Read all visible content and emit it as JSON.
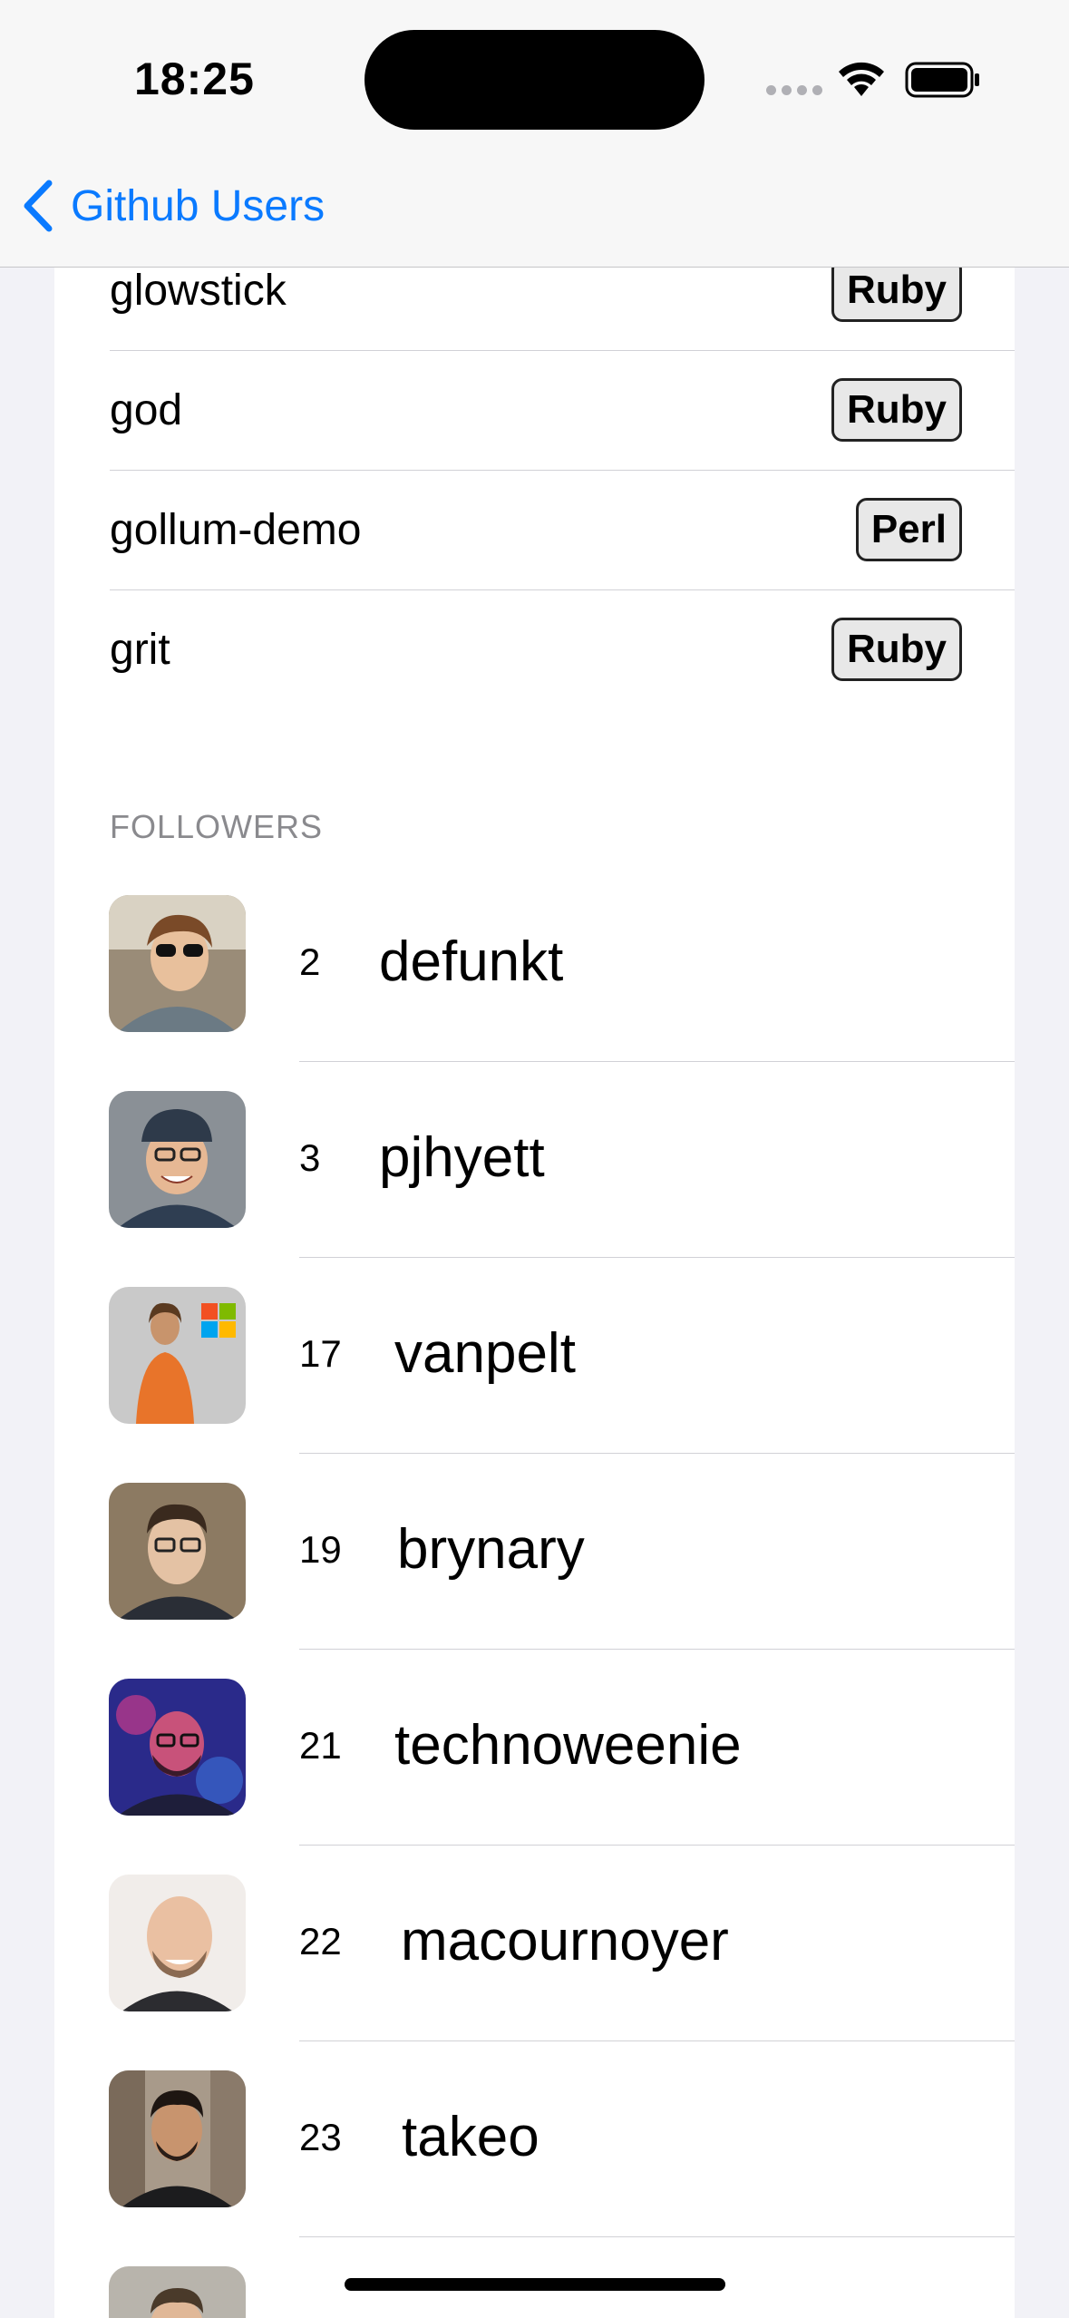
{
  "status_bar": {
    "time": "18:25"
  },
  "nav": {
    "back_label": "Github Users"
  },
  "repos": [
    {
      "name": "glowstick",
      "language": "Ruby"
    },
    {
      "name": "god",
      "language": "Ruby"
    },
    {
      "name": "gollum-demo",
      "language": "Perl"
    },
    {
      "name": "grit",
      "language": "Ruby"
    }
  ],
  "followers_section": {
    "header": "FOLLOWERS"
  },
  "followers": [
    {
      "id": "2",
      "login": "defunkt"
    },
    {
      "id": "3",
      "login": "pjhyett"
    },
    {
      "id": "17",
      "login": "vanpelt"
    },
    {
      "id": "19",
      "login": "brynary"
    },
    {
      "id": "21",
      "login": "technoweenie"
    },
    {
      "id": "22",
      "login": "macournoyer"
    },
    {
      "id": "23",
      "login": "takeo"
    },
    {
      "id": "",
      "login": ""
    }
  ],
  "colors": {
    "accent": "#0A7AFF",
    "background": "#F2F2F7",
    "card": "#FFFFFF"
  }
}
